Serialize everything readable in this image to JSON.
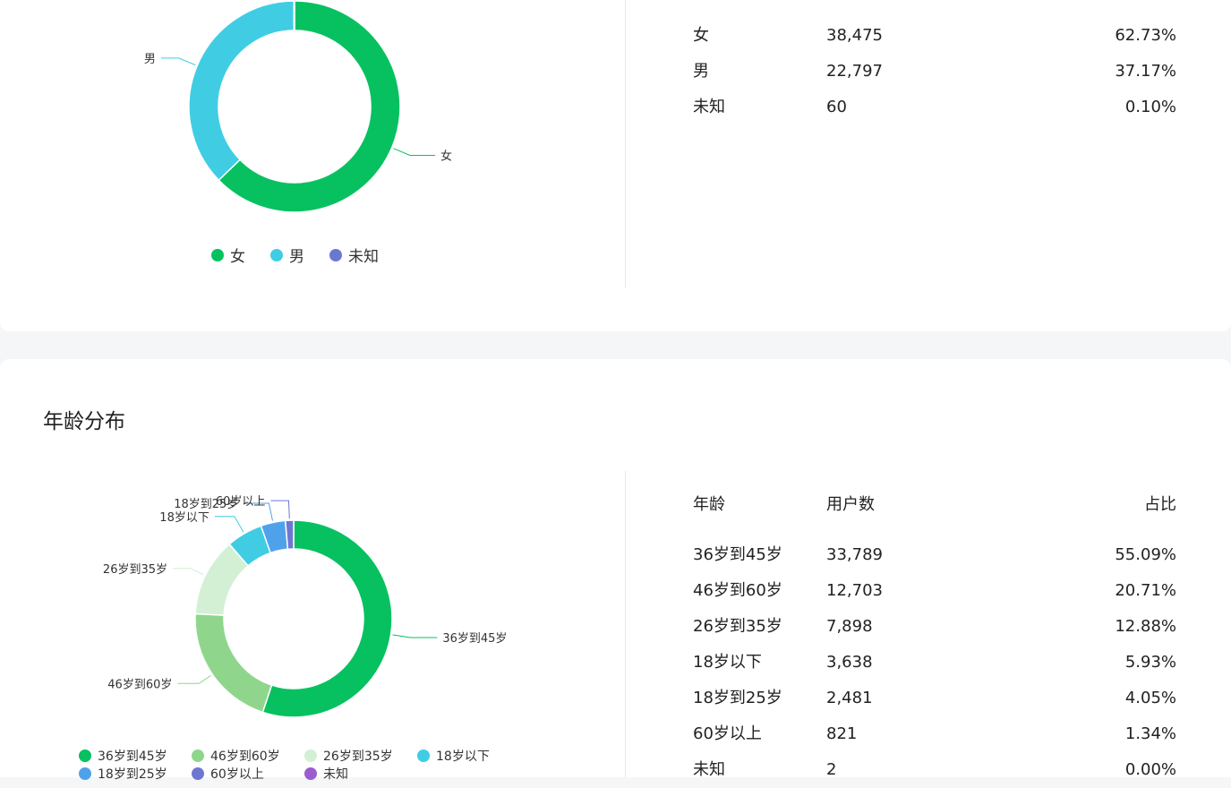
{
  "gender": {
    "legend": [
      {
        "label": "女",
        "color": "#07c160"
      },
      {
        "label": "男",
        "color": "#40cde4"
      },
      {
        "label": "未知",
        "color": "#6d77d1"
      }
    ],
    "rows": [
      {
        "label": "女",
        "users": "38,475",
        "ratio": "62.73%"
      },
      {
        "label": "男",
        "users": "22,797",
        "ratio": "37.17%"
      },
      {
        "label": "未知",
        "users": "60",
        "ratio": "0.10%"
      }
    ]
  },
  "age": {
    "title": "年龄分布",
    "headers": {
      "age": "年龄",
      "users": "用户数",
      "ratio": "占比"
    },
    "legend": [
      {
        "label": "36岁到45岁",
        "color": "#07c160"
      },
      {
        "label": "46岁到60岁",
        "color": "#8fd68c"
      },
      {
        "label": "26岁到35岁",
        "color": "#d3f0d4"
      },
      {
        "label": "18岁以下",
        "color": "#40cde4"
      },
      {
        "label": "18岁到25岁",
        "color": "#4fa2ea"
      },
      {
        "label": "60岁以上",
        "color": "#6d77d1"
      },
      {
        "label": "未知",
        "color": "#9b5ccf"
      }
    ],
    "rows": [
      {
        "label": "36岁到45岁",
        "users": "33,789",
        "ratio": "55.09%"
      },
      {
        "label": "46岁到60岁",
        "users": "12,703",
        "ratio": "20.71%"
      },
      {
        "label": "26岁到35岁",
        "users": "7,898",
        "ratio": "12.88%"
      },
      {
        "label": "18岁以下",
        "users": "3,638",
        "ratio": "5.93%"
      },
      {
        "label": "18岁到25岁",
        "users": "2,481",
        "ratio": "4.05%"
      },
      {
        "label": "60岁以上",
        "users": "821",
        "ratio": "1.34%"
      },
      {
        "label": "未知",
        "users": "2",
        "ratio": "0.00%"
      }
    ]
  },
  "chart_data": [
    {
      "type": "pie",
      "categories": [
        "女",
        "男",
        "未知"
      ],
      "values": [
        62.73,
        37.17,
        0.1
      ],
      "colors": [
        "#07c160",
        "#40cde4",
        "#6d77d1"
      ],
      "legend": "bottom"
    },
    {
      "type": "pie",
      "title": "年龄分布",
      "categories": [
        "36岁到45岁",
        "46岁到60岁",
        "26岁到35岁",
        "18岁以下",
        "18岁到25岁",
        "60岁以上",
        "未知"
      ],
      "values": [
        55.09,
        20.71,
        12.88,
        5.93,
        4.05,
        1.34,
        0.0
      ],
      "colors": [
        "#07c160",
        "#8fd68c",
        "#d3f0d4",
        "#40cde4",
        "#4fa2ea",
        "#6d77d1",
        "#9b5ccf"
      ],
      "legend": "bottom"
    }
  ]
}
